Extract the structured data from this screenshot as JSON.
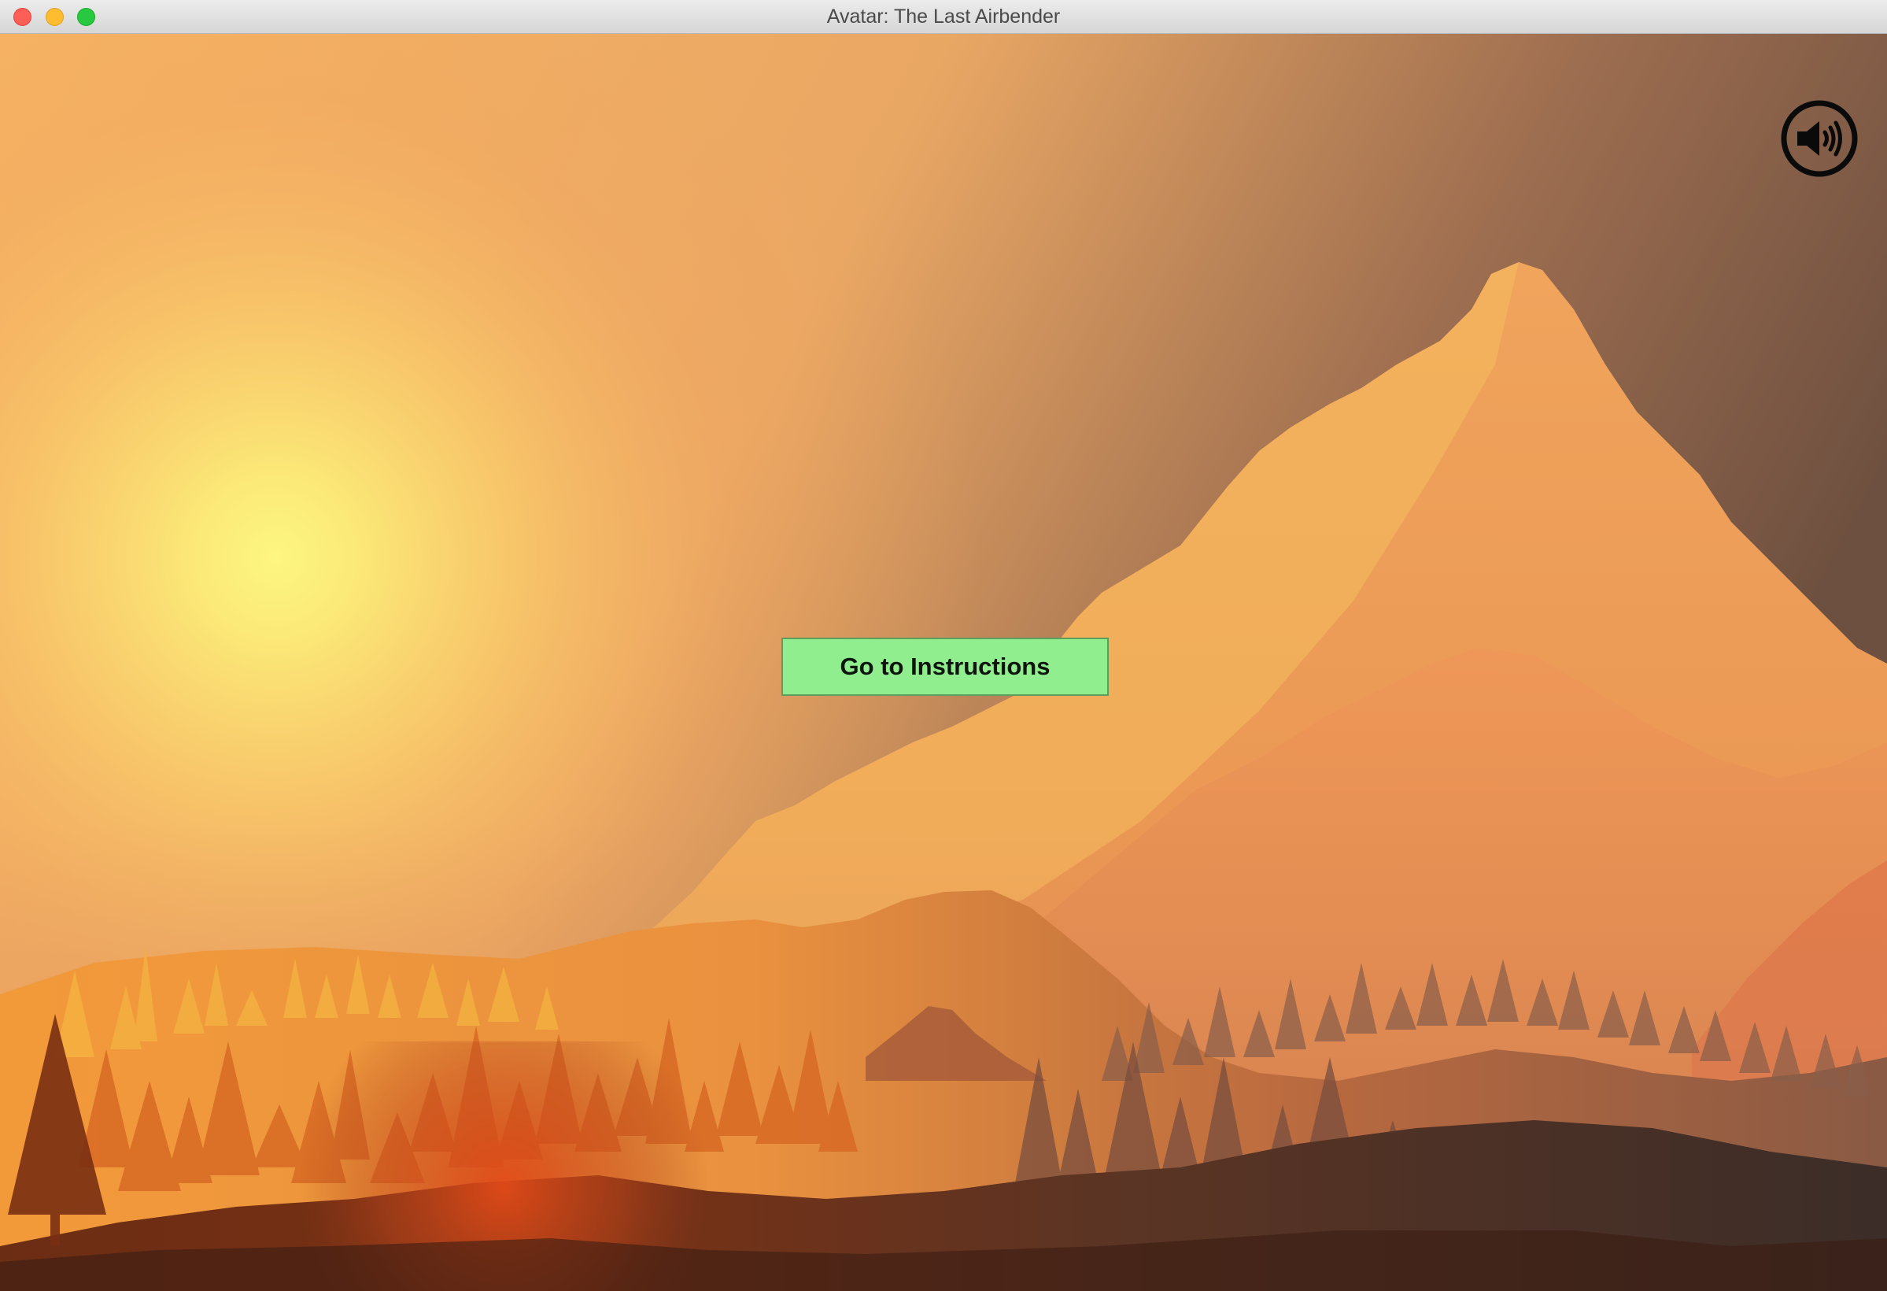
{
  "window": {
    "title": "Avatar: The Last Airbender"
  },
  "menu": {
    "instructions_button_label": "Go to Instructions",
    "sound_icon": "speaker-volume-icon"
  },
  "colors": {
    "button_fill": "#90ee8f",
    "button_text": "#0d150d",
    "sky_glow": "#fdf57c",
    "sky_warm": "#f7a85a",
    "sky_dark": "#6e5040"
  }
}
